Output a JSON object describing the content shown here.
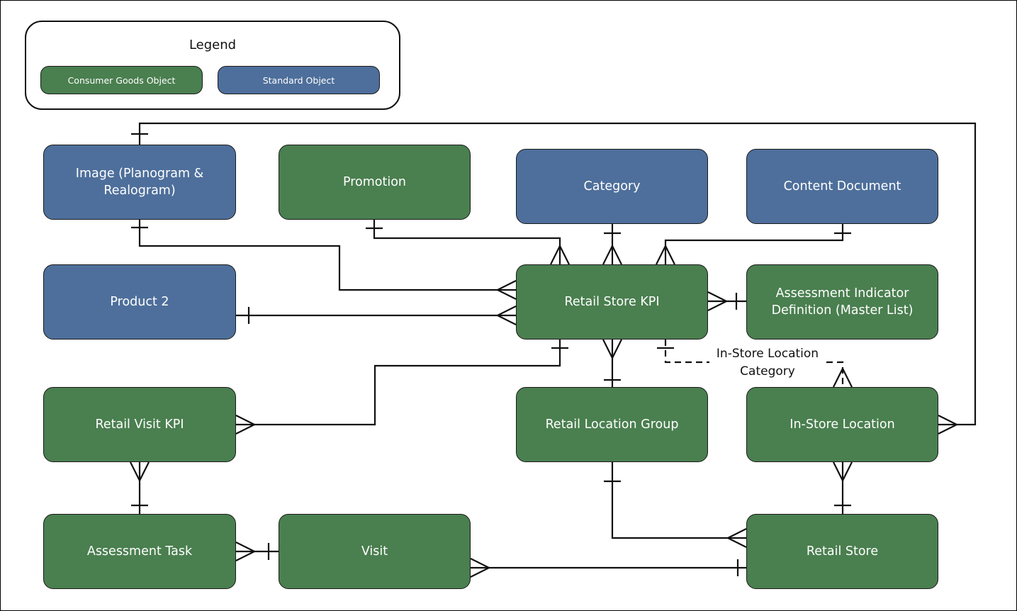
{
  "legend": {
    "title": "Legend",
    "items": [
      {
        "label": "Consumer Goods Object",
        "color": "#4a7f4f"
      },
      {
        "label": "Standard Object",
        "color": "#4e6f9b"
      }
    ]
  },
  "entities": {
    "image": {
      "label": "Image (Planogram & Realogram)",
      "type": "standard"
    },
    "promotion": {
      "label": "Promotion",
      "type": "consumer-goods"
    },
    "category": {
      "label": "Category",
      "type": "standard"
    },
    "content_document": {
      "label": "Content Document",
      "type": "standard"
    },
    "product2": {
      "label": "Product 2",
      "type": "standard"
    },
    "retail_store_kpi": {
      "label": "Retail Store KPI",
      "type": "consumer-goods"
    },
    "assessment_indicator": {
      "label": "Assessment Indicator Definition (Master List)",
      "type": "consumer-goods"
    },
    "retail_visit_kpi": {
      "label": "Retail Visit KPI",
      "type": "consumer-goods"
    },
    "retail_location_group": {
      "label": "Retail Location Group",
      "type": "consumer-goods"
    },
    "in_store_location": {
      "label": "In-Store Location",
      "type": "consumer-goods"
    },
    "assessment_task": {
      "label": "Assessment Task",
      "type": "consumer-goods"
    },
    "visit": {
      "label": "Visit",
      "type": "consumer-goods"
    },
    "retail_store": {
      "label": "Retail Store",
      "type": "consumer-goods"
    }
  },
  "relationships": [
    {
      "one": "image",
      "many": "in_store_location"
    },
    {
      "one": "image",
      "many": "retail_store_kpi"
    },
    {
      "one": "promotion",
      "many": "retail_store_kpi"
    },
    {
      "one": "category",
      "many": "retail_store_kpi"
    },
    {
      "one": "content_document",
      "many": "retail_store_kpi"
    },
    {
      "one": "product2",
      "many": "retail_store_kpi"
    },
    {
      "one": "assessment_indicator",
      "many": "retail_store_kpi"
    },
    {
      "one": "retail_store_kpi",
      "many": "retail_visit_kpi"
    },
    {
      "one": "retail_location_group",
      "many": "retail_store_kpi"
    },
    {
      "one": "retail_store_kpi",
      "many": "in_store_location",
      "label": "In-Store Location Category",
      "style": "dashed"
    },
    {
      "one": "assessment_task",
      "many": "retail_visit_kpi"
    },
    {
      "one": "visit",
      "many": "assessment_task"
    },
    {
      "one": "retail_store",
      "many": "visit"
    },
    {
      "one": "retail_location_group",
      "many": "retail_store"
    },
    {
      "one": "retail_store",
      "many": "in_store_location"
    }
  ]
}
